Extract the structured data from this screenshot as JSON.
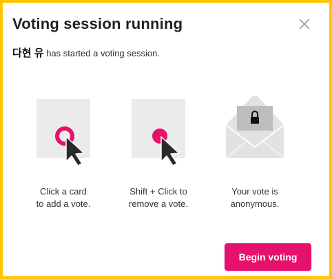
{
  "dialog": {
    "title": "Voting session running",
    "close_icon": "close-icon",
    "user_name": "다현 유",
    "subtitle_rest": " has started a voting session."
  },
  "steps": [
    {
      "caption": "Click a card\nto add a vote.",
      "icon": "card-click-icon"
    },
    {
      "caption": "Shift + Click to\nremove a vote.",
      "icon": "card-shift-click-icon"
    },
    {
      "caption": "Your vote is\nanonymous.",
      "icon": "envelope-lock-icon"
    }
  ],
  "actions": {
    "begin_label": "Begin voting"
  },
  "colors": {
    "accent": "#e6116d",
    "frame": "#ffc400",
    "card": "#ebebeb"
  }
}
